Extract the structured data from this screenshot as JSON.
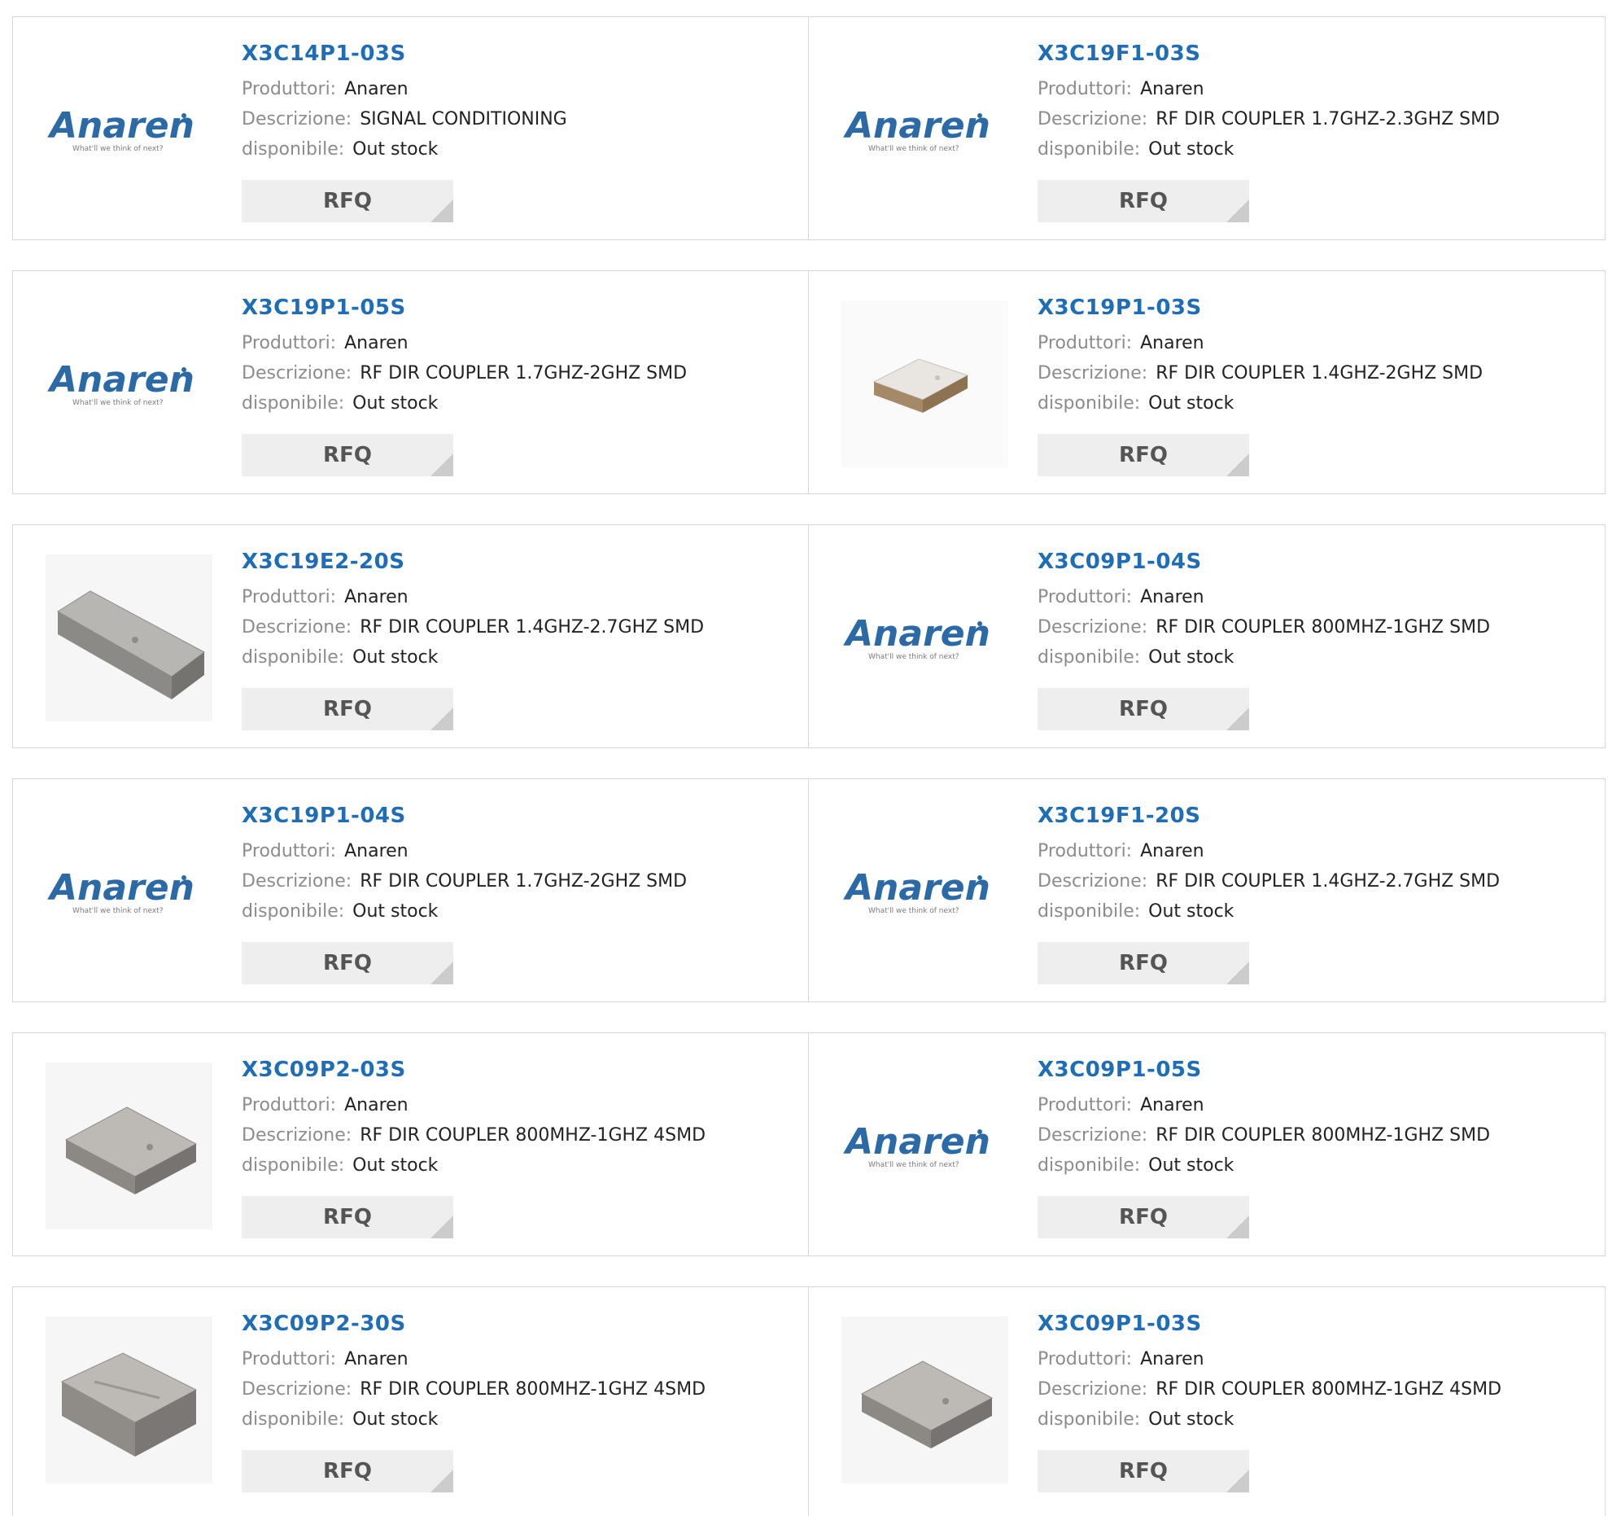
{
  "labels": {
    "manufacturer": "Produttori:",
    "description": "Descrizione:",
    "availability": "disponibile:",
    "rfq": "RFQ"
  },
  "logo": {
    "brand": "Anaren",
    "tagline": "What'll we think of next?",
    "brand_color": "#2b6aa6"
  },
  "colors": {
    "title": "#1f6db7",
    "label": "#8c8c8c",
    "value": "#222222",
    "button_bg": "#eeeeee"
  },
  "products": [
    {
      "part": "X3C14P1-03S",
      "manufacturer": "Anaren",
      "description": "SIGNAL CONDITIONING",
      "availability": "Out stock",
      "image": "anaren-logo"
    },
    {
      "part": "X3C19F1-03S",
      "manufacturer": "Anaren",
      "description": "RF DIR COUPLER 1.7GHZ-2.3GHZ SMD",
      "availability": "Out stock",
      "image": "anaren-logo"
    },
    {
      "part": "X3C19P1-05S",
      "manufacturer": "Anaren",
      "description": "RF DIR COUPLER 1.7GHZ-2GHZ SMD",
      "availability": "Out stock",
      "image": "anaren-logo"
    },
    {
      "part": "X3C19P1-03S",
      "manufacturer": "Anaren",
      "description": "RF DIR COUPLER 1.4GHZ-2GHZ SMD",
      "availability": "Out stock",
      "image": "smd-square-small"
    },
    {
      "part": "X3C19E2-20S",
      "manufacturer": "Anaren",
      "description": "RF DIR COUPLER 1.4GHZ-2.7GHZ SMD",
      "availability": "Out stock",
      "image": "smd-long"
    },
    {
      "part": "X3C09P1-04S",
      "manufacturer": "Anaren",
      "description": "RF DIR COUPLER 800MHZ-1GHZ SMD",
      "availability": "Out stock",
      "image": "anaren-logo"
    },
    {
      "part": "X3C19P1-04S",
      "manufacturer": "Anaren",
      "description": "RF DIR COUPLER 1.7GHZ-2GHZ SMD",
      "availability": "Out stock",
      "image": "anaren-logo"
    },
    {
      "part": "X3C19F1-20S",
      "manufacturer": "Anaren",
      "description": "RF DIR COUPLER 1.4GHZ-2.7GHZ SMD",
      "availability": "Out stock",
      "image": "anaren-logo"
    },
    {
      "part": "X3C09P2-03S",
      "manufacturer": "Anaren",
      "description": "RF DIR COUPLER 800MHZ-1GHZ 4SMD",
      "availability": "Out stock",
      "image": "smd-square"
    },
    {
      "part": "X3C09P1-05S",
      "manufacturer": "Anaren",
      "description": "RF DIR COUPLER 800MHZ-1GHZ SMD",
      "availability": "Out stock",
      "image": "anaren-logo"
    },
    {
      "part": "X3C09P2-30S",
      "manufacturer": "Anaren",
      "description": "RF DIR COUPLER 800MHZ-1GHZ 4SMD",
      "availability": "Out stock",
      "image": "smd-thick"
    },
    {
      "part": "X3C09P1-03S",
      "manufacturer": "Anaren",
      "description": "RF DIR COUPLER 800MHZ-1GHZ 4SMD",
      "availability": "Out stock",
      "image": "smd-square"
    }
  ]
}
